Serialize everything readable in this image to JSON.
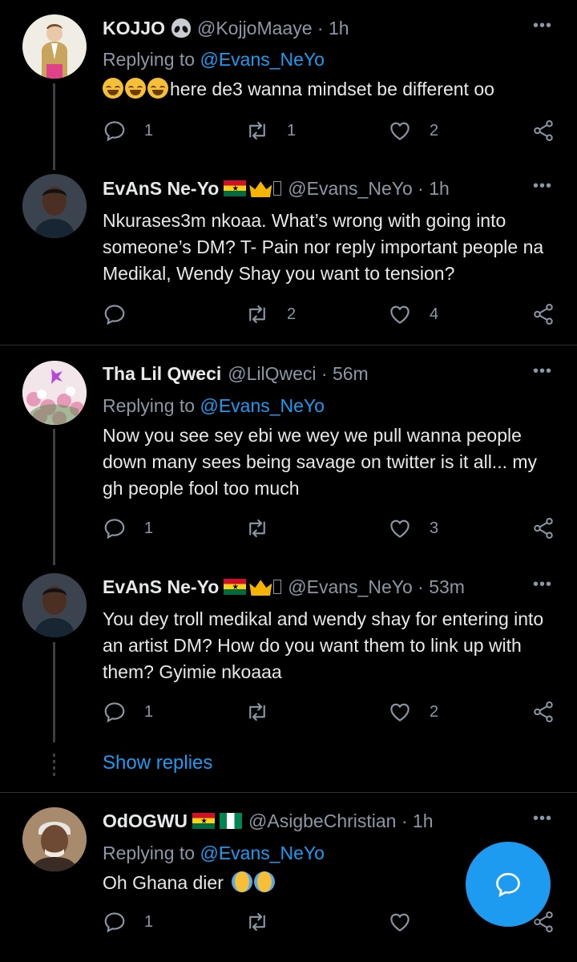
{
  "tweets": [
    {
      "name": "KOJJO",
      "handle": "@KojjoMaaye · 1h",
      "replying_label": "Replying to ",
      "replying_to": "@Evans_NeYo",
      "text": "here de3 wanna mindset be different oo",
      "replies": "1",
      "retweets": "1",
      "likes": "2"
    },
    {
      "name": "EvAnS Ne-Yo",
      "handle": "@Evans_NeYo · 1h",
      "text": "Nkurases3m nkoaa. What’s wrong with going into someone’s DM? T- Pain nor reply important people na Medikal, Wendy Shay you want to tension?",
      "replies": "",
      "retweets": "2",
      "likes": "4"
    },
    {
      "name": "Tha Lil Qweci",
      "handle": "@LilQweci · 56m",
      "replying_label": "Replying to ",
      "replying_to": "@Evans_NeYo",
      "text": "Now you see sey ebi we wey we pull wanna people down many sees being savage on twitter is it all... my gh people fool too much",
      "replies": "1",
      "retweets": "",
      "likes": "3"
    },
    {
      "name": "EvAnS Ne-Yo",
      "handle": "@Evans_NeYo · 53m",
      "text": "You dey troll medikal and wendy shay for entering into an artist DM? How do you want them to link up with them? Gyimie nkoaaa",
      "replies": "1",
      "retweets": "",
      "likes": "2"
    },
    {
      "name": "OdOGWU",
      "handle": "@AsigbeChristian · 1h",
      "replying_label": "Replying to ",
      "replying_to": "@Evans_NeYo",
      "text": "Oh Ghana dier",
      "replies": "1",
      "retweets": "",
      "likes": ""
    }
  ],
  "show_replies": "Show replies",
  "colors": {
    "accent": "#1d9bf0",
    "background": "#000000",
    "muted": "#8b98a5"
  },
  "icons": [
    "reply-icon",
    "retweet-icon",
    "like-icon",
    "share-icon",
    "more-icon",
    "compose-reply-icon"
  ]
}
